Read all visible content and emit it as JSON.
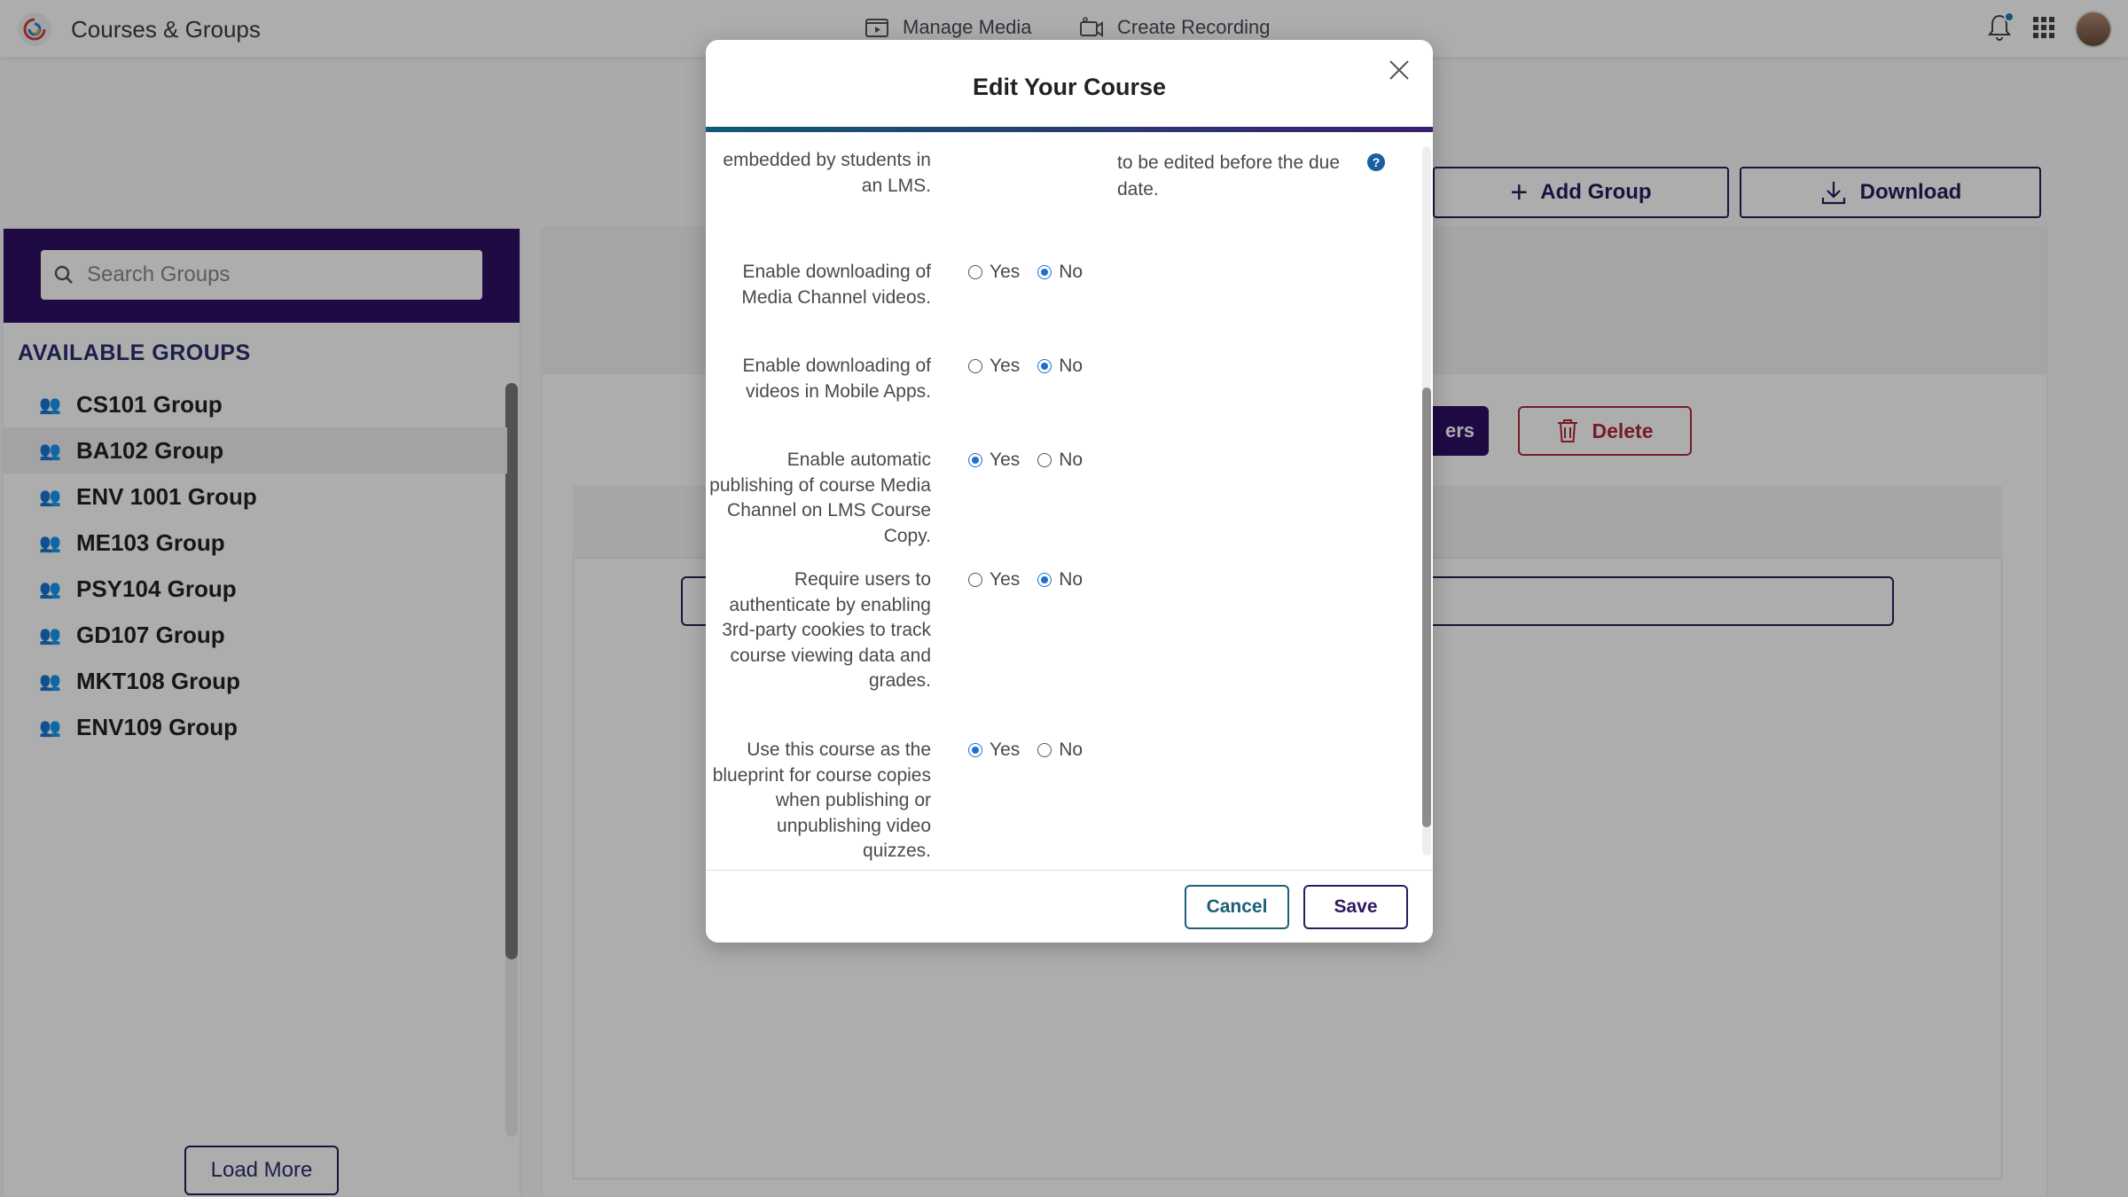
{
  "app": {
    "title": "Courses & Groups",
    "logo_icon": "logo-swirl-icon"
  },
  "topnav": {
    "manage_media": "Manage Media",
    "create_recording": "Create Recording"
  },
  "sidebar": {
    "search_placeholder": "Search Groups",
    "available_title": "AVAILABLE GROUPS",
    "groups": [
      {
        "label": "CS101 Group"
      },
      {
        "label": "BA102 Group"
      },
      {
        "label": "ENV 1001 Group"
      },
      {
        "label": "ME103 Group"
      },
      {
        "label": "PSY104 Group"
      },
      {
        "label": "GD107 Group"
      },
      {
        "label": "MKT108 Group"
      },
      {
        "label": "ENV109 Group"
      }
    ],
    "load_more": "Load More"
  },
  "main": {
    "add_group": "Add Group",
    "download": "Download",
    "users_partial": "ers",
    "delete": "Delete"
  },
  "modal": {
    "title": "Edit Your Course",
    "top_label": "embedded by students in an LMS.",
    "top_note": "to be edited before the due date.",
    "help": "?",
    "options": [
      {
        "label": "Enable downloading of Media Channel videos.",
        "value": "No"
      },
      {
        "label": "Enable downloading of videos in Mobile Apps.",
        "value": "No"
      },
      {
        "label": "Enable automatic publishing of course Media Channel on LMS Course Copy.",
        "value": "Yes"
      },
      {
        "label": "Require users to authenticate by enabling 3rd-party cookies to track course viewing data and grades.",
        "value": "No"
      },
      {
        "label": "Use this course as the blueprint for course copies when publishing or unpublishing video quizzes.",
        "value": "Yes"
      }
    ],
    "yes": "Yes",
    "no": "No",
    "cancel": "Cancel",
    "save": "Save"
  },
  "colors": {
    "brand": "#2e1065",
    "accent_teal": "#1d5f78",
    "danger": "#b0283c",
    "radio": "#1f6fd1"
  }
}
